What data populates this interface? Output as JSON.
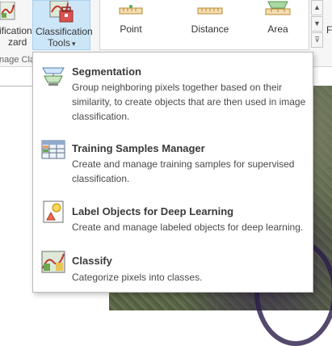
{
  "ribbon": {
    "wizard_line1": "ification",
    "wizard_line2": "zard",
    "group_label": "nage Cla",
    "classification_tools_line1": "Classification",
    "classification_tools_line2": "Tools",
    "gallery": [
      {
        "label": "Point"
      },
      {
        "label": "Distance"
      },
      {
        "label": "Area"
      }
    ],
    "right_edge_letter": "F"
  },
  "menu": {
    "items": [
      {
        "title": "Segmentation",
        "description": "Group neighboring pixels together based on their similarity, to create objects that are then used in image classification.",
        "icon": "segmentation-icon"
      },
      {
        "title": "Training Samples Manager",
        "description": "Create and manage training samples for supervised classification.",
        "icon": "training-samples-icon"
      },
      {
        "title": "Label Objects for Deep Learning",
        "description": "Create and manage labeled objects for deep learning.",
        "icon": "label-objects-icon"
      },
      {
        "title": "Classify",
        "description": "Categorize pixels into classes.",
        "icon": "classify-icon"
      }
    ]
  }
}
